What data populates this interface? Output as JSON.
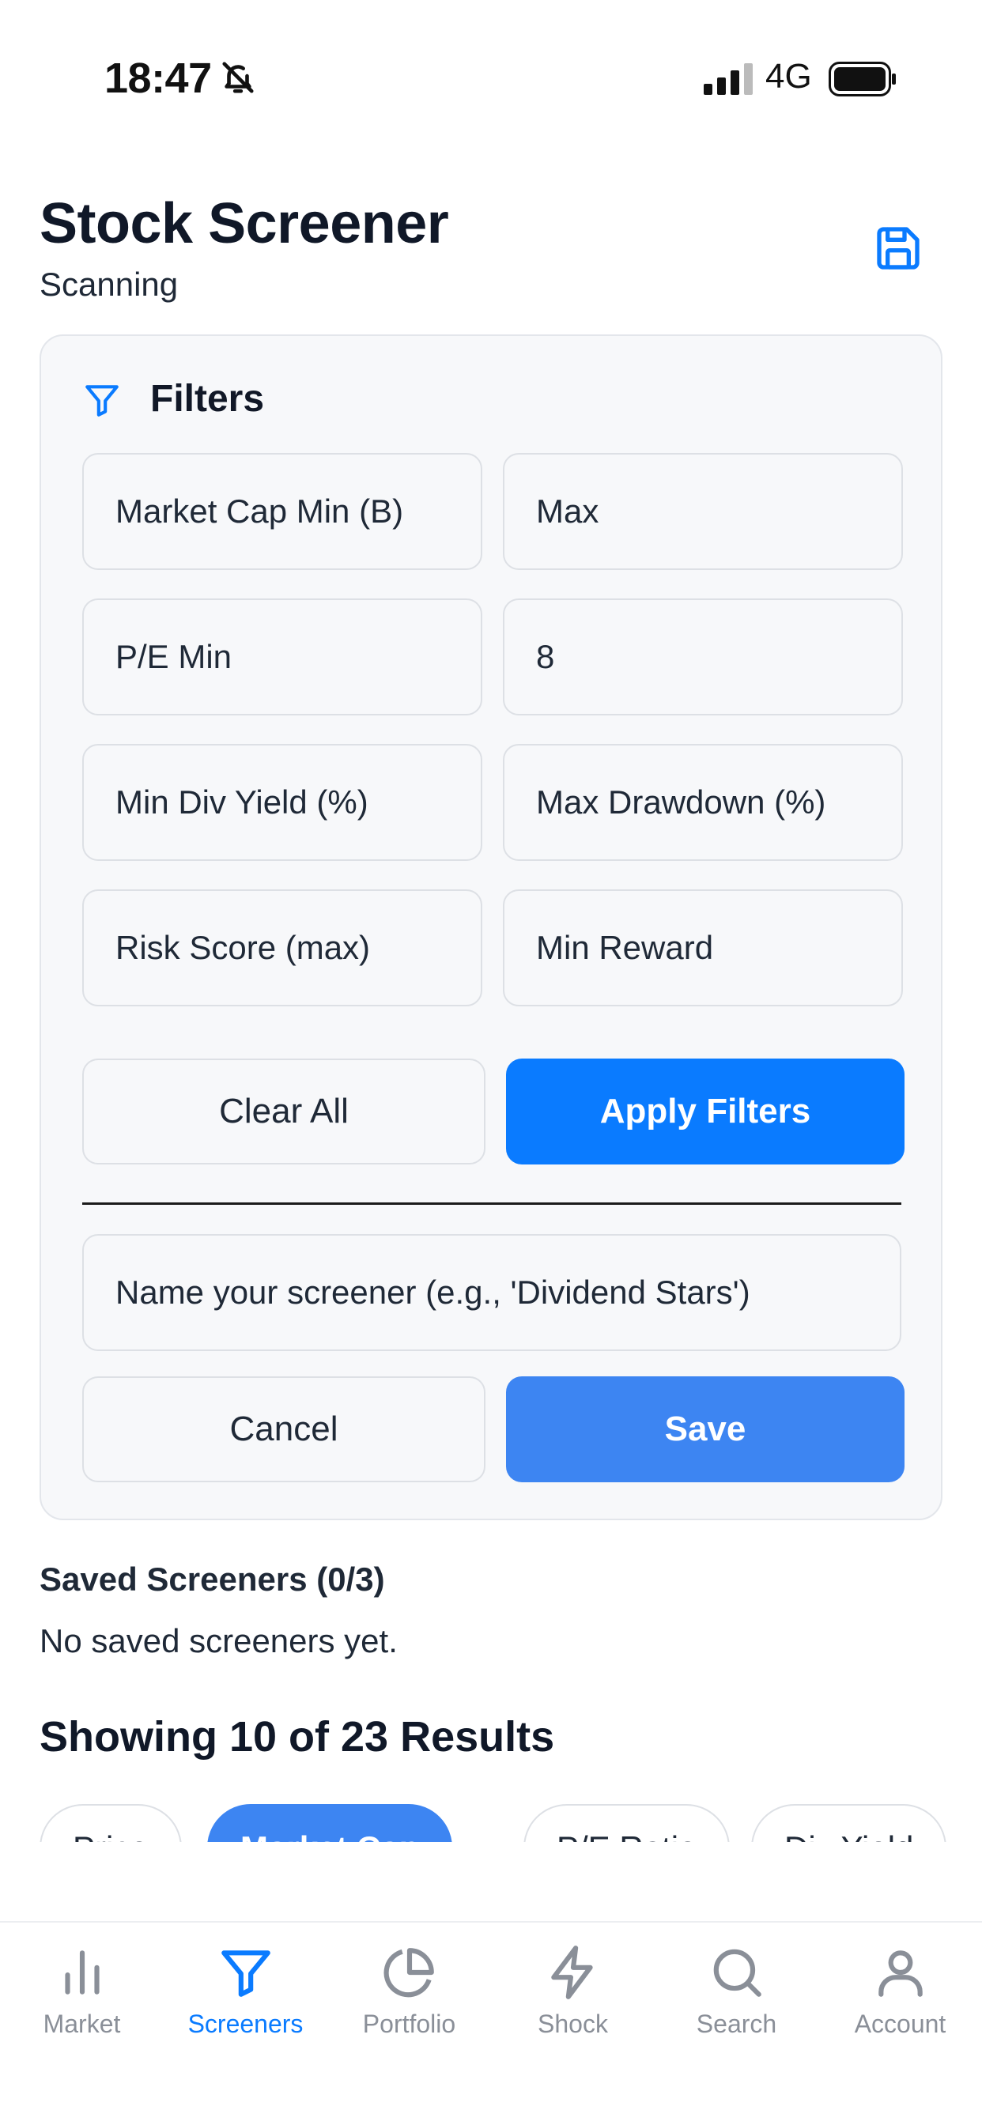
{
  "status_bar": {
    "time": "18:47",
    "network": "4G"
  },
  "header": {
    "title": "Stock Screener",
    "subtitle": "Scanning",
    "save_icon": "save-icon"
  },
  "filters": {
    "title": "Filters",
    "icon": "filter-icon",
    "fields": {
      "market_cap_min": "Market Cap Min (B)",
      "market_cap_max": "Max",
      "pe_min": "P/E Min",
      "pe_max_value": "8",
      "min_div_yield": "Min Div Yield (%)",
      "max_drawdown": "Max Drawdown (%)",
      "risk_score_max": "Risk Score (max)",
      "min_reward": "Min Reward"
    },
    "clear_label": "Clear All",
    "apply_label": "Apply Filters",
    "name_placeholder": "Name your screener (e.g., 'Dividend Stars')",
    "cancel_label": "Cancel",
    "save_label": "Save"
  },
  "saved": {
    "title": "Saved Screeners (0/3)",
    "empty_text": "No saved screeners yet."
  },
  "results": {
    "title": "Showing 10 of 23 Results",
    "sort_chips": [
      "Price",
      "Market Cap",
      "P/E Ratio",
      "Div Yield"
    ],
    "active_chip": "Market Cap"
  },
  "tab_bar": {
    "items": [
      {
        "label": "Market",
        "icon": "bar-chart-icon"
      },
      {
        "label": "Screeners",
        "icon": "filter-icon"
      },
      {
        "label": "Portfolio",
        "icon": "pie-chart-icon"
      },
      {
        "label": "Shock",
        "icon": "lightning-icon"
      },
      {
        "label": "Search",
        "icon": "search-icon"
      },
      {
        "label": "Account",
        "icon": "user-icon"
      }
    ],
    "active": "Screeners"
  },
  "colors": {
    "accent": "#0a7bff",
    "save_button": "#3d85f2",
    "inactive_tab": "#8a8f98",
    "card_background": "#f7f8fa"
  }
}
